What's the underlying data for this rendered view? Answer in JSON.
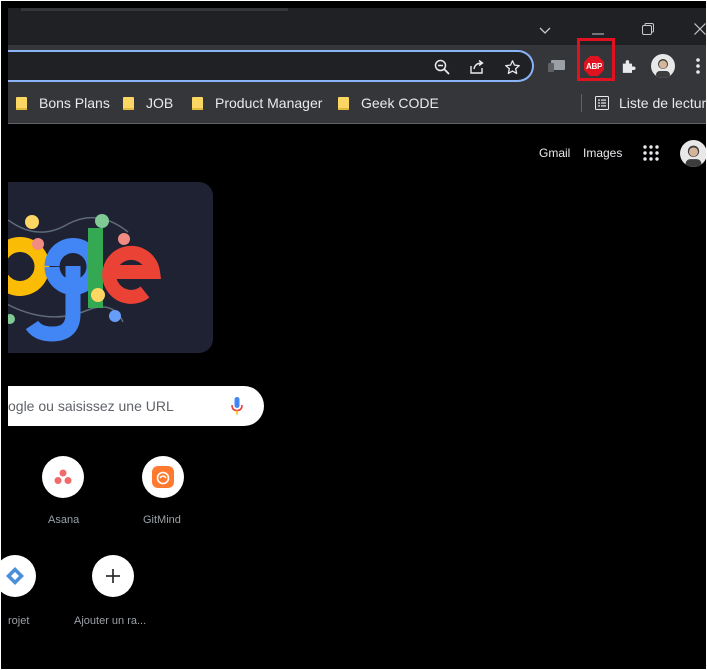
{
  "toolbar": {
    "abp_label": "ABP"
  },
  "bookmarks": [
    {
      "label": "Bons Plans"
    },
    {
      "label": "JOB"
    },
    {
      "label": "Product Manager"
    },
    {
      "label": "Geek CODE"
    }
  ],
  "reading_list": {
    "label": "Liste de lecture"
  },
  "ntp": {
    "gmail": "Gmail",
    "images": "Images",
    "search_placeholder": "ogle ou saisissez une URL",
    "shortcuts": [
      {
        "label": "Asana"
      },
      {
        "label": "GitMind"
      },
      {
        "label": "rojet"
      },
      {
        "label": "Ajouter un ra..."
      }
    ]
  },
  "colors": {
    "accent_focus": "#8ab4f8",
    "highlight_box": "#e0121f",
    "abp_red": "#e0121f",
    "folder": "#fcd663"
  }
}
